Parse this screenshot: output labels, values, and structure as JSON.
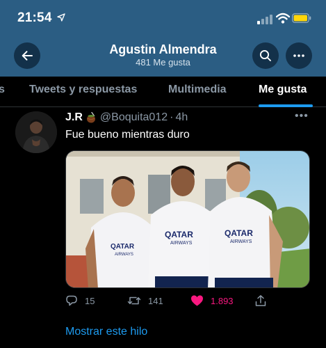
{
  "status_bar": {
    "time": "21:54"
  },
  "header": {
    "title": "Agustin Almendra",
    "subtitle": "481 Me gusta",
    "icons": {
      "back": "arrow-left-icon",
      "search": "search-icon",
      "more": "more-icon"
    }
  },
  "tabs": [
    {
      "label": "s"
    },
    {
      "label": "Tweets y respuestas"
    },
    {
      "label": "Multimedia"
    },
    {
      "label": "Me gusta",
      "active": true
    }
  ],
  "tweet": {
    "author_name": "J.R",
    "author_emoji": "mate-emoji",
    "handle": "@Boquita012",
    "dot": "·",
    "time": "4h",
    "text": "Fue bueno mientras duro",
    "media": {
      "shirt_sponsor": "QATAR",
      "shirt_sponsor_sub": "AIRWAYS"
    },
    "replies": "15",
    "retweets": "141",
    "likes": "1.893",
    "colors": {
      "like": "#f91880",
      "link": "#1d9bf0",
      "header": "#2b5d83"
    }
  },
  "show_thread": "Mostrar este hilo"
}
